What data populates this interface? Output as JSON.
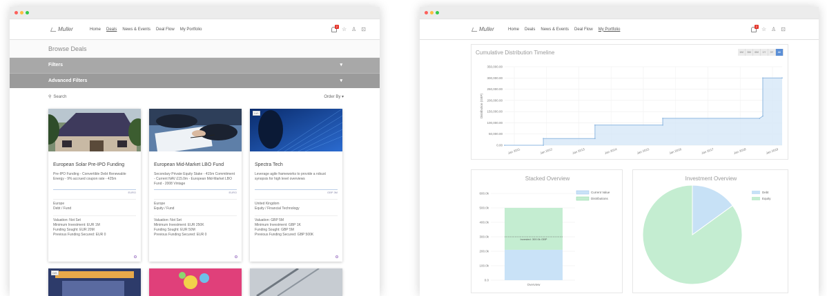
{
  "colors": {
    "red": "#fc605c",
    "yellow": "#fdbc40",
    "green": "#34c84a",
    "accent": "#5b8fd6",
    "filter": "#a8a8a8",
    "timeline_fill": "#d6e7f8",
    "timeline_line": "#8eb7e0",
    "current_value": "#c9e2f7",
    "distributions": "#c4edd1",
    "debt": "#c7e1f6",
    "equity": "#c4edd1"
  },
  "left": {
    "logo": "Muller",
    "nav": [
      "Home",
      "Deals",
      "News & Events",
      "Deal Flow",
      "My Portfolio"
    ],
    "notification_count": "2",
    "page_title": "Browse Deals",
    "filters_label": "Filters",
    "advanced_filters_label": "Advanced Filters",
    "search_label": "Search",
    "order_label": "Order By ▾",
    "cards": [
      {
        "tag": "",
        "title": "European Solar Pre-IPO Funding",
        "desc": "Pre-IPO Funding - Convertible Debt Renewable Energy - 9% accrued coupon rate - 425m",
        "currency": "EURO",
        "region": "Europe",
        "type": "Debt / Fund",
        "valuation": "Valuation: Not Set",
        "min_investment": "Minimum Investment: EUR 1M",
        "funding_sought": "Funding Sought: EUR 20M",
        "previous": "Previous Funding Secured: EUR 0"
      },
      {
        "tag": "",
        "title": "European Mid-Market LBO Fund",
        "desc": "Secondary Private Equity Stake - 415m Commitment - Current NAV £15.0m - European Mid-Market LBO Fund - 2008 Vintage",
        "currency": "EURO",
        "region": "Europe",
        "type": "Equity / Fund",
        "valuation": "Valuation: Not Set",
        "min_investment": "Minimum Investment: EUR 250K",
        "funding_sought": "Funding Sought: EUR 50M",
        "previous": "Previous Funding Secured: EUR 0"
      },
      {
        "tag": "DIS",
        "title": "Spectra Tech",
        "desc": "Leverage agile frameworks to provide a robust synopsis for high level overviews",
        "currency": "GBP 3M",
        "region": "United Kingdom",
        "type": "Equity / Financial Technology",
        "valuation": "Valuation: GBP 5M",
        "min_investment": "Minimum Investment: GBP 1K",
        "funding_sought": "Funding Sought: GBP 5M",
        "previous": "Previous Funding Secured: GBP 500K"
      }
    ],
    "second_row_tags": [
      "DIS",
      "",
      ""
    ]
  },
  "right": {
    "logo": "Muller",
    "nav": [
      "Home",
      "Deals",
      "News & Events",
      "Deal Flow",
      "My Portfolio"
    ],
    "notification_count": "2",
    "timeline": {
      "title": "Cumulative Distribution Timeline",
      "range_buttons": [
        "1M",
        "3M",
        "6M",
        "1Y",
        "3Y",
        "All"
      ],
      "selected_range": "All"
    },
    "stacked_title": "Stacked Overview",
    "investment_title": "Investment Overview"
  },
  "chart_data": [
    {
      "type": "area",
      "title": "Cumulative Distribution Timeline",
      "ylabel": "Distribution (GBP)",
      "xlabel": "",
      "x": [
        "Jan 2011",
        "Jan 2012",
        "Jan 2013",
        "Jan 2014",
        "Jan 2015",
        "Jan 2016",
        "Jan 2017",
        "Jan 2018",
        "Jan 2019"
      ],
      "yticks": [
        "0.00",
        "50,000.00",
        "100,000.00",
        "150,000.00",
        "200,000.00",
        "250,000.00",
        "300,000.00",
        "350,000.00"
      ],
      "ylim": [
        0,
        350000
      ],
      "points": [
        {
          "x": 2010.7,
          "y": 0
        },
        {
          "x": 2011.9,
          "y": 0
        },
        {
          "x": 2011.9,
          "y": 30000
        },
        {
          "x": 2013.5,
          "y": 30000
        },
        {
          "x": 2013.5,
          "y": 90000
        },
        {
          "x": 2015.6,
          "y": 90000
        },
        {
          "x": 2015.6,
          "y": 120000
        },
        {
          "x": 2018.6,
          "y": 120000
        },
        {
          "x": 2018.7,
          "y": 130000
        },
        {
          "x": 2018.7,
          "y": 300000
        },
        {
          "x": 2019.3,
          "y": 300000
        }
      ],
      "grid": true
    },
    {
      "type": "bar",
      "title": "Stacked Overview",
      "categories": [
        "Overview"
      ],
      "series": [
        {
          "name": "Current Value",
          "values": [
            210000
          ]
        },
        {
          "name": "Distributions",
          "values": [
            290000
          ]
        }
      ],
      "yticks": [
        "0.0",
        "100.0k",
        "200.0k",
        "300.0k",
        "400.0k",
        "500.0k",
        "600.0k"
      ],
      "ylim": [
        0,
        600000
      ],
      "annotation": "Invested: 300.0k GBP",
      "annotation_value": 300000,
      "legend": "top-right"
    },
    {
      "type": "pie",
      "title": "Investment Overview",
      "labels": [
        "Debt",
        "Equity"
      ],
      "values": [
        15,
        85
      ],
      "legend": "top-right"
    }
  ]
}
